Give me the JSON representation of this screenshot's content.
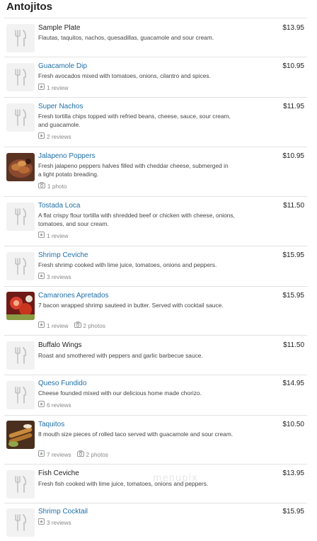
{
  "section": {
    "title": "Antojitos"
  },
  "items": [
    {
      "name": "Sample Plate",
      "price": "$13.95",
      "description": "Flautas, taquitos, nachos, quesadillas, guacamole and sour cream.",
      "reviews": "",
      "photos": ""
    },
    {
      "name": "Guacamole Dip",
      "price": "$10.95",
      "description": "Fresh avocados mixed with tomatoes, onions, cilantro and spices.",
      "reviews": "1 review",
      "photos": ""
    },
    {
      "name": "Super Nachos",
      "price": "$11.95",
      "description": "Fresh tortilla chips topped with refried beans, cheese, sauce, sour cream, and guacamole.",
      "reviews": "2 reviews",
      "photos": ""
    },
    {
      "name": "Jalapeno Poppers",
      "price": "$10.95",
      "description": "Fresh jalapeno peppers halves filled with cheddar cheese, submerged in a light potato breading.",
      "reviews": "",
      "photos": "1 photo"
    },
    {
      "name": "Tostada Loca",
      "price": "$11.50",
      "description": "A flat crispy flour tortilla with shredded beef or chicken with cheese, onions, tomatoes, and sour cream.",
      "reviews": "1 review",
      "photos": ""
    },
    {
      "name": "Shrimp Ceviche",
      "price": "$15.95",
      "description": "Fresh shrimp cooked with lime juice, tomatoes, onions and peppers.",
      "reviews": "3 reviews",
      "photos": ""
    },
    {
      "name": "Camarones Apretados",
      "price": "$15.95",
      "description": "7 bacon wrapped shrimp sauteed in butter. Served with cocktail sauce.",
      "reviews": "1 review",
      "photos": "2 photos"
    },
    {
      "name": "Buffalo Wings",
      "price": "$11.50",
      "description": "Roast and smothered with peppers and garlic barbecue sauce.",
      "reviews": "",
      "photos": ""
    },
    {
      "name": "Queso Fundido",
      "price": "$14.95",
      "description": "Cheese founded mixed with our delicious home made chorizo.",
      "reviews": "6 reviews",
      "photos": ""
    },
    {
      "name": "Taquitos",
      "price": "$10.50",
      "description": "8 mouth size pieces of rolled taco served with guacamole and sour cream.",
      "reviews": "7 reviews",
      "photos": "2 photos"
    },
    {
      "name": "Fish Ceviche",
      "price": "$13.95",
      "description": "Fresh fish cooked with lime juice, tomatoes, onions and peppers.",
      "reviews": "",
      "photos": ""
    },
    {
      "name": "Shrimp Cocktail",
      "price": "$15.95",
      "description": "",
      "reviews": "3 reviews",
      "photos": ""
    }
  ],
  "watermark": "menupix",
  "icons": {
    "placeholder": "fork-knife-icon",
    "review": "review-icon",
    "photo": "camera-icon"
  },
  "colors": {
    "link": "#1e6fa8",
    "text": "#222222",
    "muted": "#888888"
  }
}
